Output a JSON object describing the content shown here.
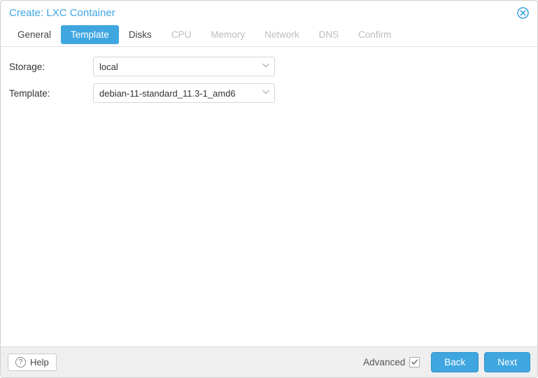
{
  "header": {
    "title": "Create: LXC Container"
  },
  "tabs": [
    {
      "label": "General",
      "state": "enabled"
    },
    {
      "label": "Template",
      "state": "active"
    },
    {
      "label": "Disks",
      "state": "enabled"
    },
    {
      "label": "CPU",
      "state": "disabled"
    },
    {
      "label": "Memory",
      "state": "disabled"
    },
    {
      "label": "Network",
      "state": "disabled"
    },
    {
      "label": "DNS",
      "state": "disabled"
    },
    {
      "label": "Confirm",
      "state": "disabled"
    }
  ],
  "form": {
    "storage": {
      "label": "Storage:",
      "value": "local"
    },
    "template": {
      "label": "Template:",
      "value": "debian-11-standard_11.3-1_amd6"
    }
  },
  "footer": {
    "help": "Help",
    "advanced_label": "Advanced",
    "advanced_checked": true,
    "back": "Back",
    "next": "Next"
  }
}
